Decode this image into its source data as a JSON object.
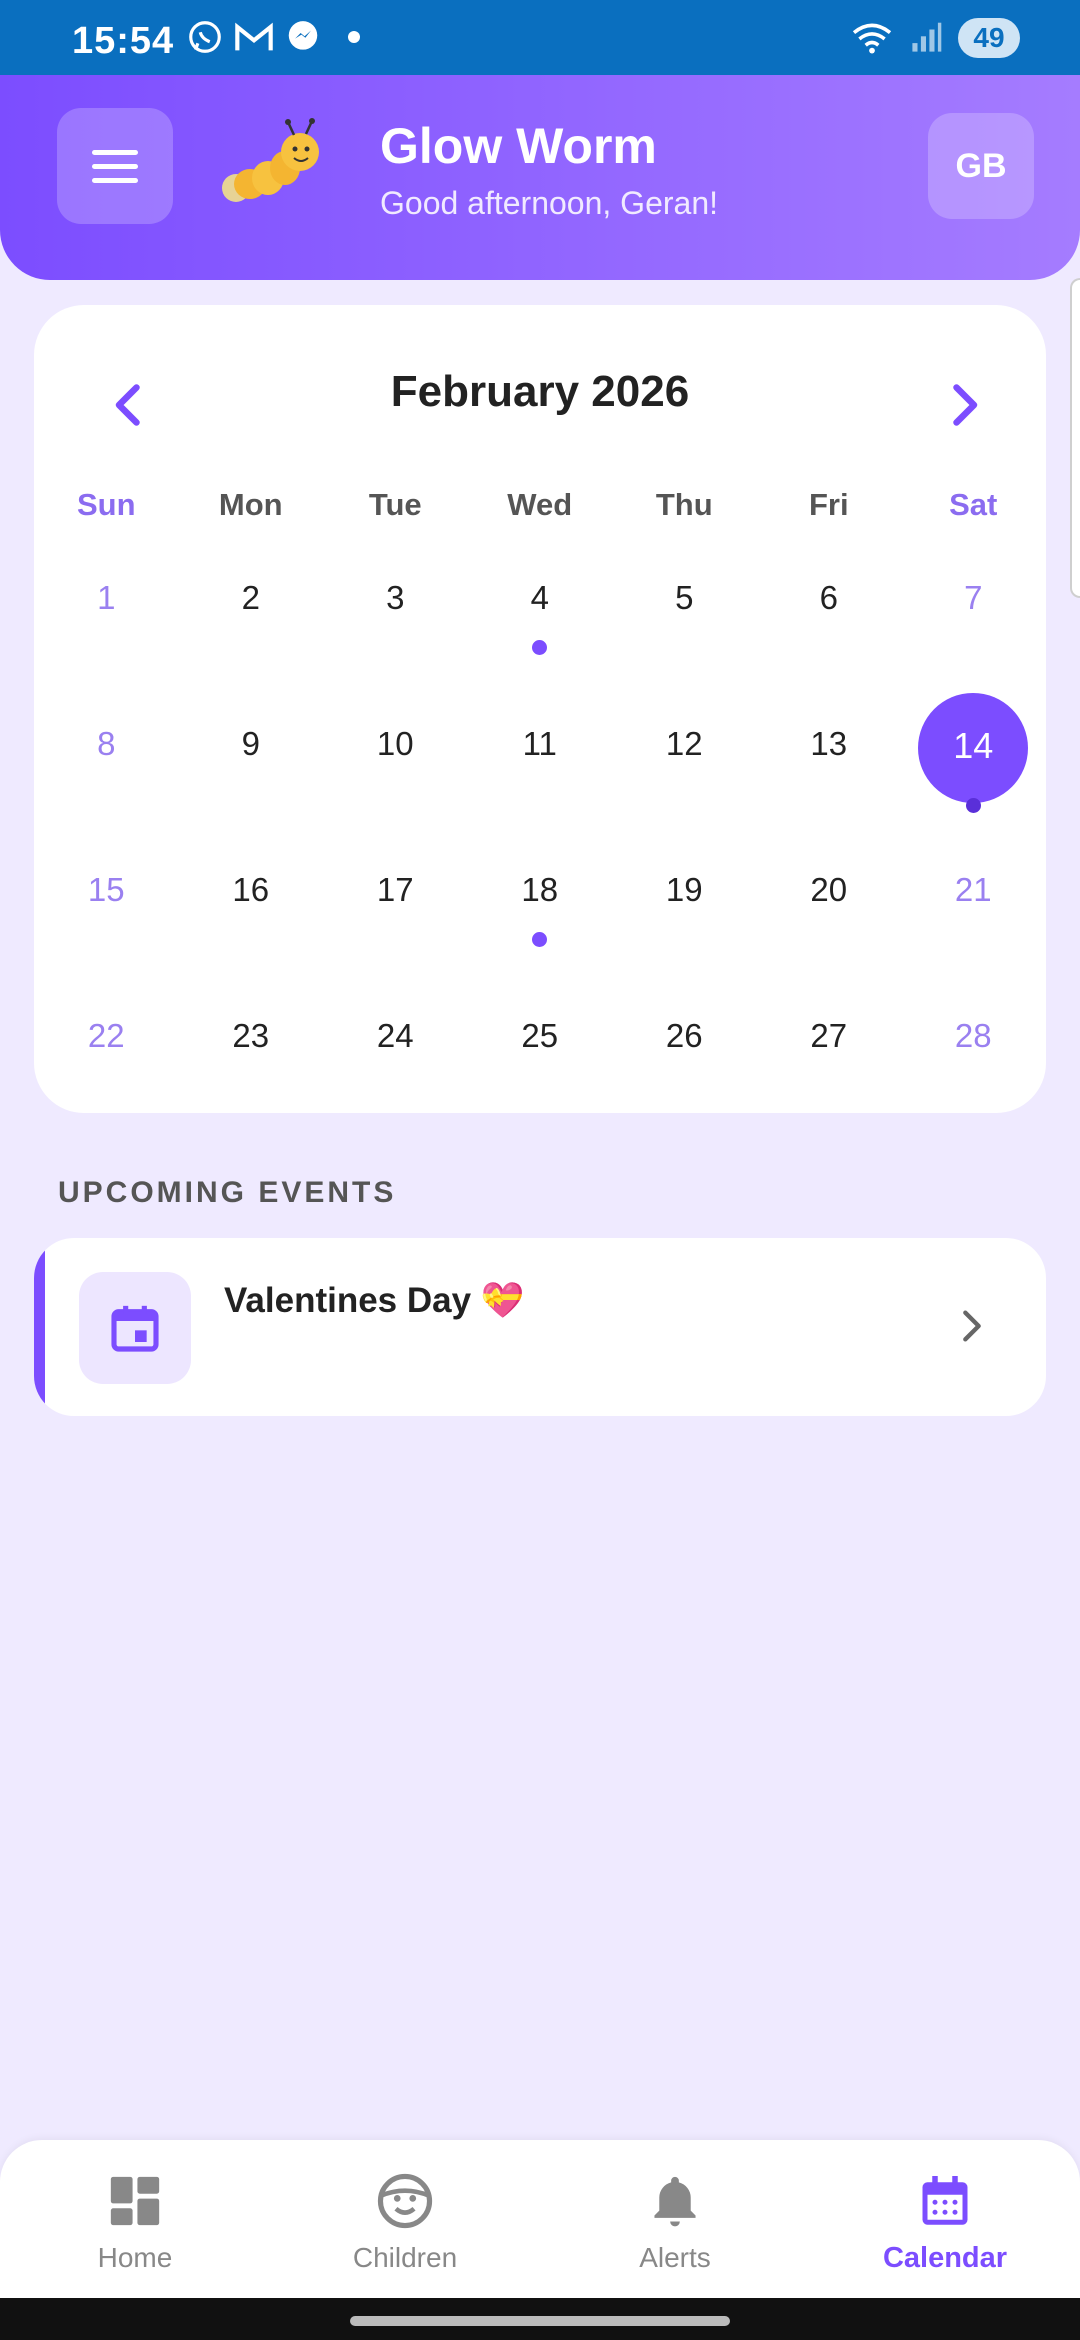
{
  "status_bar": {
    "time": "15:54",
    "battery": "49"
  },
  "header": {
    "app_title": "Glow Worm",
    "greeting": "Good afternoon, Geran!",
    "avatar_initials": "GB"
  },
  "calendar": {
    "month_title": "February 2026",
    "weekdays": [
      "Sun",
      "Mon",
      "Tue",
      "Wed",
      "Thu",
      "Fri",
      "Sat"
    ],
    "weeks": [
      [
        "1",
        "2",
        "3",
        "4",
        "5",
        "6",
        "7"
      ],
      [
        "8",
        "9",
        "10",
        "11",
        "12",
        "13",
        "14"
      ],
      [
        "15",
        "16",
        "17",
        "18",
        "19",
        "20",
        "21"
      ],
      [
        "22",
        "23",
        "24",
        "25",
        "26",
        "27",
        "28"
      ]
    ],
    "selected_day": "14",
    "event_days": [
      "4",
      "14",
      "18"
    ]
  },
  "upcoming": {
    "section_label": "UPCOMING EVENTS",
    "events": [
      {
        "title": "Valentines Day 💝"
      }
    ]
  },
  "bottom_nav": {
    "items": [
      {
        "label": "Home",
        "icon": "dashboard-icon"
      },
      {
        "label": "Children",
        "icon": "child-face-icon"
      },
      {
        "label": "Alerts",
        "icon": "bell-icon"
      },
      {
        "label": "Calendar",
        "icon": "calendar-icon"
      }
    ],
    "active": "Calendar"
  },
  "colors": {
    "accent": "#7c4dff",
    "background": "#efeaff",
    "status_bar": "#0a6fbf"
  }
}
